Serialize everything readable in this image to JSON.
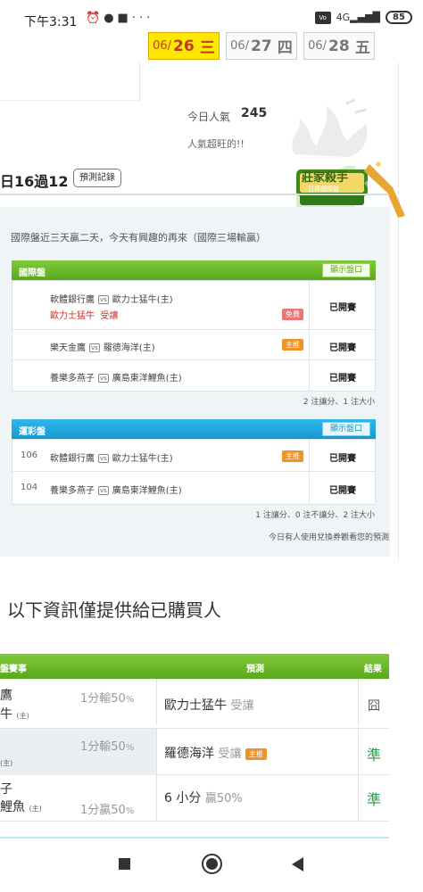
{
  "status_bar": {
    "time": "下午3:31",
    "left_icons": [
      "alarm-icon",
      "chat-icon",
      "media-icon",
      "more-icon"
    ],
    "volte": "Vo LTE",
    "signal": "4G",
    "battery": "85"
  },
  "date_tabs": [
    {
      "prefix": "06/",
      "day": "26",
      "weekday": "三",
      "active": true
    },
    {
      "prefix": "06/",
      "day": "27",
      "weekday": "四",
      "active": false
    },
    {
      "prefix": "06/",
      "day": "28",
      "weekday": "五",
      "active": false
    }
  ],
  "popularity": {
    "label": "今日人氣",
    "value": "245",
    "note": "人氣超旺的!!"
  },
  "summary": {
    "text": "日16過12",
    "record_button": "預測記錄"
  },
  "badge": {
    "title": "莊家殺手",
    "subtitle": "日棒國際盤",
    "ribbon": "長期聯盟"
  },
  "intro": "國際盤近三天贏二天，今天有興趣的再來（國際三場輸贏）",
  "intl_section": {
    "title": "國際盤",
    "show_button": "顯示盤口",
    "rows": [
      {
        "away": "軟體銀行鷹",
        "vs": "vs",
        "home": "歐力士猛牛(主)",
        "pick": "歐力士猛牛",
        "pick_note": "受讓",
        "tag": "免費",
        "status": "已開賽"
      },
      {
        "away": "樂天金鷹",
        "vs": "vs",
        "home": "羅德海洋(主)",
        "tag": "主推",
        "status": "已開賽"
      },
      {
        "away": "養樂多燕子",
        "vs": "vs",
        "home": "廣島東洋鯉魚(主)",
        "status": "已開賽"
      }
    ],
    "stat": "2 注讓分、1 注大小"
  },
  "lottery_section": {
    "title": "運彩盤",
    "show_button": "顯示盤口",
    "rows": [
      {
        "num": "106",
        "away": "軟體銀行鷹",
        "vs": "vs",
        "home": "歐力士猛牛(主)",
        "tag": "主推",
        "status": "已開賽"
      },
      {
        "num": "104",
        "away": "養樂多燕子",
        "vs": "vs",
        "home": "廣島東洋鯉魚(主)",
        "status": "已開賽"
      }
    ],
    "stat": "1 注讓分、0 注不讓分、2 注大小",
    "note": "今日有人使用兌換券觀看您的預測"
  },
  "buyers": {
    "title": "以下資訊僅提供給已購買人",
    "headers": {
      "match": "盤賽事",
      "pick": "預測",
      "result": "結果"
    },
    "rows": [
      {
        "team1": "鷹",
        "team2": "牛",
        "home_mark": "(主)",
        "odds": "1分輸50",
        "odds_unit": "%",
        "pick": "歐力士猛牛",
        "pick_sub": "受讓",
        "tag": "",
        "result": "囧",
        "result_type": "pending"
      },
      {
        "team1": "",
        "team2": "",
        "home_mark": "(主)",
        "odds": "1分輸50",
        "odds_unit": "%",
        "pick": "羅德海洋",
        "pick_sub": "受讓",
        "tag": "主推",
        "result": "準",
        "result_type": "ok"
      },
      {
        "team1": "子",
        "team2": "鯉魚",
        "home_mark": "(主)",
        "odds": "1分贏50",
        "odds_unit": "%",
        "pick": "6 小分",
        "pick_sub": "贏50%",
        "tag": "",
        "result": "準",
        "result_type": "ok"
      }
    ]
  },
  "colors": {
    "accent_green": "#5aa81e",
    "accent_blue": "#1498d1",
    "active_date": "#ffe800",
    "win_green": "#2a9d49"
  }
}
